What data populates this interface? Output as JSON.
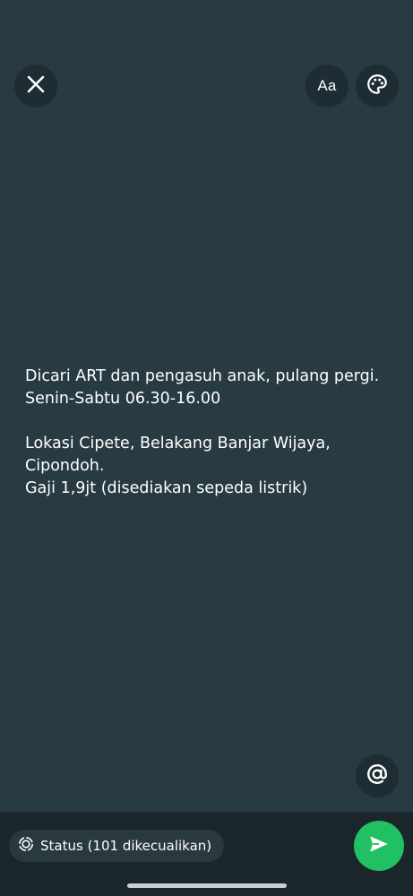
{
  "toolbar": {
    "close_icon": "close-icon",
    "font_label": "Aa",
    "palette_icon": "palette-icon",
    "mention_icon": "at-icon"
  },
  "status": {
    "text": "Dicari ART dan pengasuh anak, pulang pergi.\nSenin-Sabtu 06.30-16.00\n\nLokasi Cipete, Belakang Banjar Wijaya,\nCipondoh.\nGaji 1,9jt (disediakan sepeda listrik)"
  },
  "footer": {
    "audience_icon": "status-ring-icon",
    "audience_label": "Status (101 dikecualikan)",
    "send_icon": "send-icon"
  },
  "colors": {
    "background": "#283a42",
    "button_bg": "#1e2c33",
    "footer_bg": "#1b262b",
    "send_green": "#21c063"
  }
}
